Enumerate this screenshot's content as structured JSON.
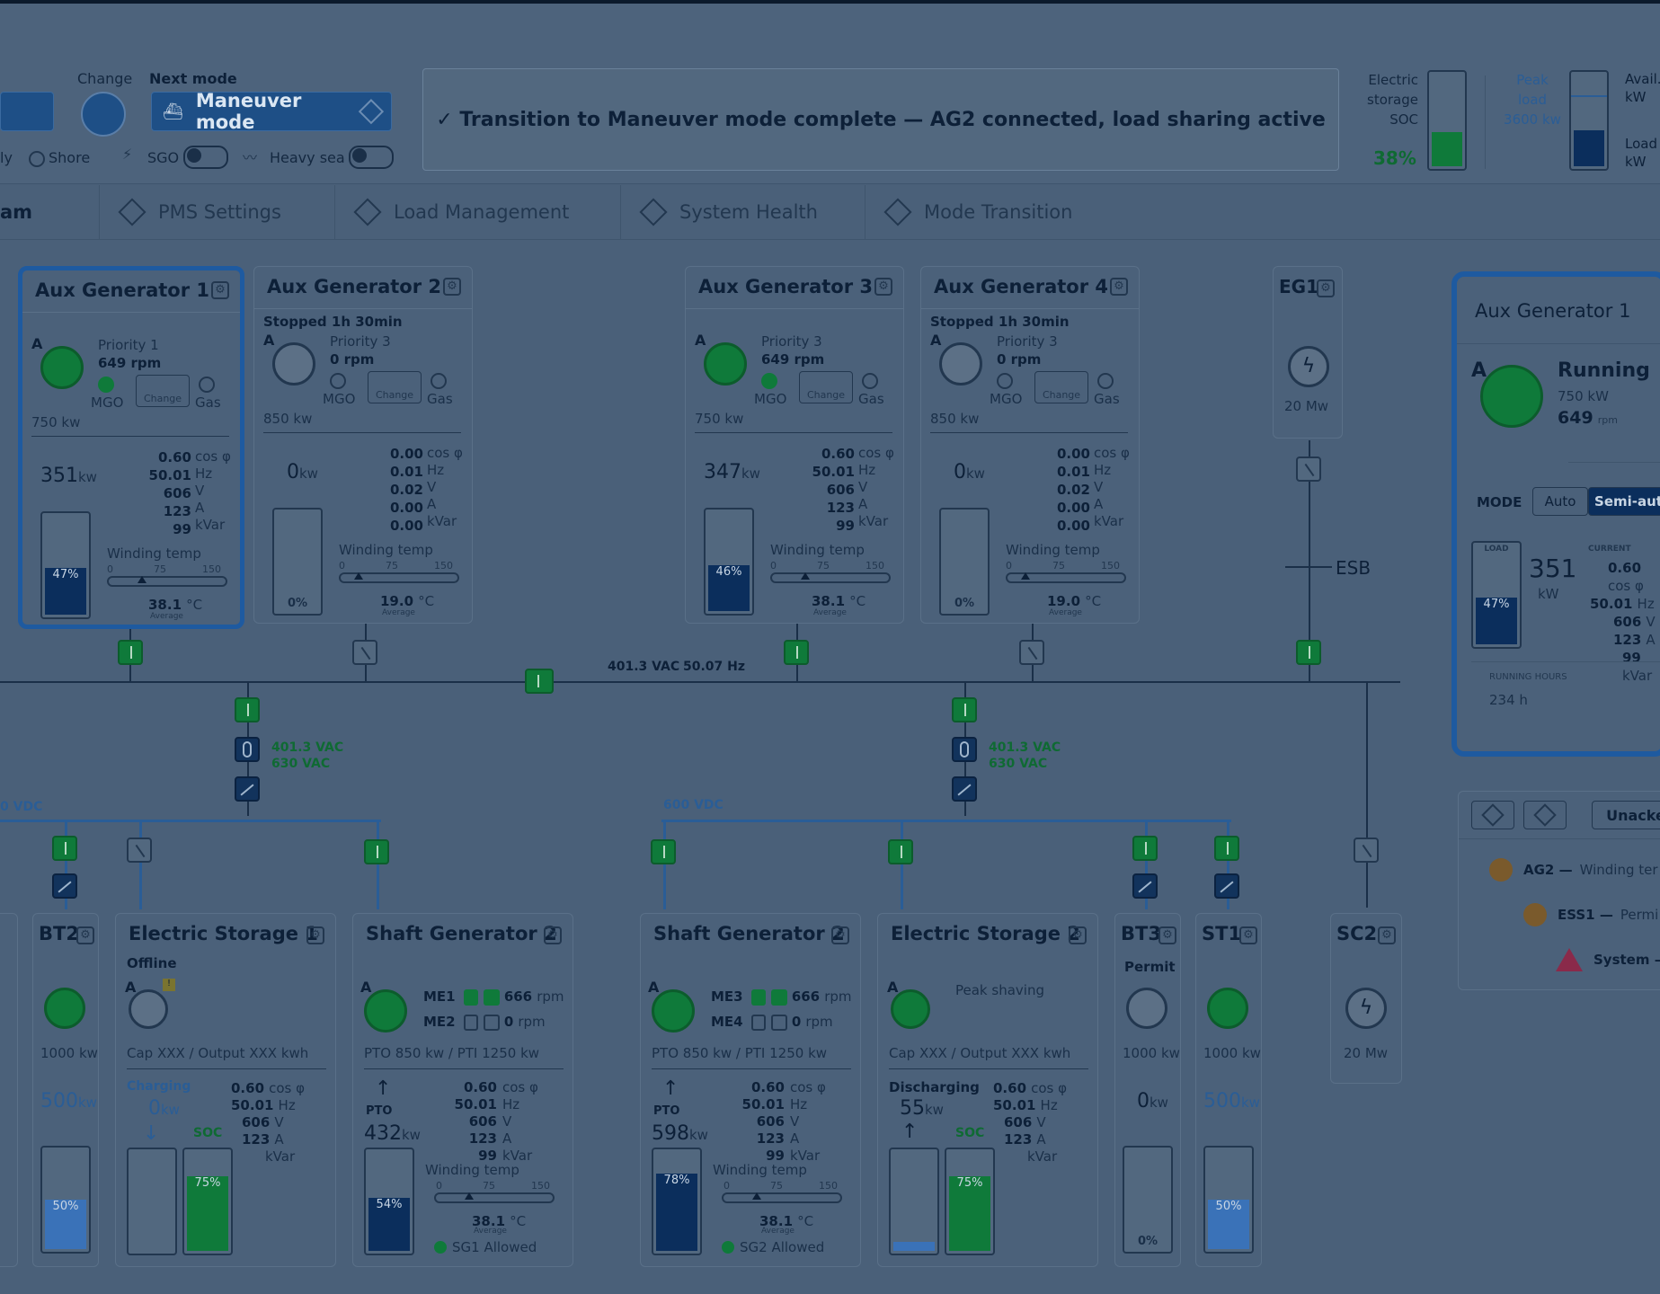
{
  "header": {
    "change_label": "Change",
    "next_mode_label": "Next mode",
    "next_mode_value": "Maneuver mode",
    "shore_label": "Shore",
    "partial_left_label": "ly",
    "sgo_label": "SGO",
    "heavy_sea_label": "Heavy sea",
    "message": "✓ Transition to Maneuver mode complete — AG2 connected, load sharing active",
    "storage": {
      "label_line1": "Electric",
      "label_line2": "storage",
      "label_line3": "SOC",
      "value": "38%",
      "level": 0.38
    },
    "peak": {
      "label_line1": "Peak",
      "label_line2": "load",
      "label_line3": "3600 kw",
      "avail_line1": "Avail.",
      "avail_line2": "kW",
      "load_line1": "Load",
      "load_line2": "kW"
    }
  },
  "tabs": [
    {
      "label": "am"
    },
    {
      "label": "PMS Settings"
    },
    {
      "label": "Load Management"
    },
    {
      "label": "System Health"
    },
    {
      "label": "Mode Transition"
    }
  ],
  "generators": [
    {
      "title": "Aux Generator 1",
      "status": "",
      "priority": "Priority 1",
      "rpm": "649 rpm",
      "rated": "750 kw",
      "kw": "351",
      "cos": "0.60",
      "hz": "50.01",
      "v": "606",
      "a": "123",
      "kvar": "99",
      "load": "47%",
      "load_val": 0.47,
      "temp": "38.1",
      "running": true
    },
    {
      "title": "Aux Generator 2",
      "status": "Stopped 1h 30min",
      "priority": "Priority 3",
      "rpm": "0 rpm",
      "rated": "850 kw",
      "kw": "0",
      "cos": "0.00",
      "hz": "0.01",
      "v": "0.02",
      "a": "0.00",
      "kvar": "0.00",
      "load": "0%",
      "load_val": 0,
      "temp": "19.0",
      "running": false
    },
    {
      "title": "Aux Generator 3",
      "status": "",
      "priority": "Priority 3",
      "rpm": "649 rpm",
      "rated": "750 kw",
      "kw": "347",
      "cos": "0.60",
      "hz": "50.01",
      "v": "606",
      "a": "123",
      "kvar": "99",
      "load": "46%",
      "load_val": 0.46,
      "temp": "38.1",
      "running": true
    },
    {
      "title": "Aux Generator 4",
      "status": "Stopped 1h 30min",
      "priority": "Priority 3",
      "rpm": "0 rpm",
      "rated": "850 kw",
      "kw": "0",
      "cos": "0.00",
      "hz": "0.01",
      "v": "0.02",
      "a": "0.00",
      "kvar": "0.00",
      "load": "0%",
      "load_val": 0,
      "temp": "19.0",
      "running": false
    }
  ],
  "common": {
    "mgo": "MGO",
    "gas": "Gas",
    "change": "Change",
    "winding_temp": "Winding temp",
    "average": "Average",
    "unit_kw": "kw",
    "unit_cos": "cos φ",
    "unit_hz": "Hz",
    "unit_v": "V",
    "unit_a": "A",
    "unit_kvar": "kVar",
    "unit_c": "°C",
    "scale_0": "0",
    "scale_75": "75",
    "scale_150": "150"
  },
  "eg1": {
    "title": "EG1",
    "rating": "20 Mw",
    "esb": "ESB"
  },
  "bus": {
    "voltage": "401.3 VAC",
    "freq": "50.07 Hz"
  },
  "xfmr": {
    "v1": "401.3 VAC",
    "v2": "630 VAC"
  },
  "dc": {
    "left": "0 VDC",
    "right": "600 VDC"
  },
  "lower": {
    "bt2": {
      "title": "BT2",
      "rating": "1000 kw",
      "kw": "500",
      "load": "50%",
      "load_val": 0.5
    },
    "es1": {
      "title": "Electric Storage 1",
      "status": "Offline",
      "cap": "Cap XXX  / Output XXX kwh",
      "mode": "Charging",
      "kw": "0",
      "cos": "0.60",
      "hz": "50.01",
      "v": "606",
      "a": "123",
      "kvar_label": "kVar",
      "soc_label": "SOC",
      "soc": "75%",
      "soc_val": 0.75
    },
    "sg2a": {
      "title": "Shaft Generator 2",
      "me_a": "ME1",
      "me_b": "ME2",
      "rpm_a": "666",
      "rpm_b": "0",
      "pto": "PTO 850 kw / PTI 1250 kw",
      "mode": "PTO",
      "kw": "432",
      "cos": "0.60",
      "hz": "50.01",
      "v": "606",
      "a": "123",
      "kvar": "99",
      "load": "54%",
      "load_val": 0.54,
      "temp": "38.1",
      "allowed": "SG1 Allowed"
    },
    "sg2b": {
      "title": "Shaft Generator 2",
      "me_a": "ME3",
      "me_b": "ME4",
      "rpm_a": "666",
      "rpm_b": "0",
      "pto": "PTO 850 kw / PTI 1250 kw",
      "mode": "PTO",
      "kw": "598",
      "cos": "0.60",
      "hz": "50.01",
      "v": "606",
      "a": "123",
      "kvar": "99",
      "load": "78%",
      "load_val": 0.78,
      "temp": "38.1",
      "allowed": "SG2 Allowed"
    },
    "es2": {
      "title": "Electric Storage 2",
      "status": "Peak shaving",
      "cap": "Cap XXX  / Output XXX kwh",
      "mode": "Discharging",
      "kw": "55",
      "cos": "0.60",
      "hz": "50.01",
      "v": "606",
      "a": "123",
      "kvar_label": "kVar",
      "soc_label": "SOC",
      "soc": "75%",
      "soc_val": 0.75
    },
    "bt3": {
      "title": "BT3",
      "status": "Permit",
      "rating": "1000 kw",
      "kw": "0",
      "load": "0%",
      "load_val": 0
    },
    "st1": {
      "title": "ST1",
      "rating": "1000 kw",
      "kw": "500",
      "load": "50%",
      "load_val": 0.5
    },
    "sc2": {
      "title": "SC2",
      "rating": "20 Mw"
    },
    "rpm_unit": "rpm"
  },
  "detail": {
    "title": "Aux Generator 1",
    "state": "Running",
    "rated": "750 kW",
    "rpm": "649",
    "rpm_unit": "rpm",
    "mode_label": "MODE",
    "auto": "Auto",
    "semi": "Semi-aut",
    "load_label": "LOAD",
    "current_label": "CURRENT",
    "kw": "351",
    "kw_unit": "kW",
    "load": "47%",
    "load_val": 0.47,
    "cos": "0.60",
    "hz": "50.01",
    "v": "606",
    "a": "123",
    "kvar": "99",
    "hours_label": "RUNNING HOURS",
    "hours": "234 h"
  },
  "alarms": {
    "unack": "Unacke",
    "items": [
      {
        "src": "AG2 —",
        "text": "Winding ter"
      },
      {
        "src": "ESS1 —",
        "text": "Permi"
      },
      {
        "src": "System —",
        "text": ""
      }
    ]
  }
}
